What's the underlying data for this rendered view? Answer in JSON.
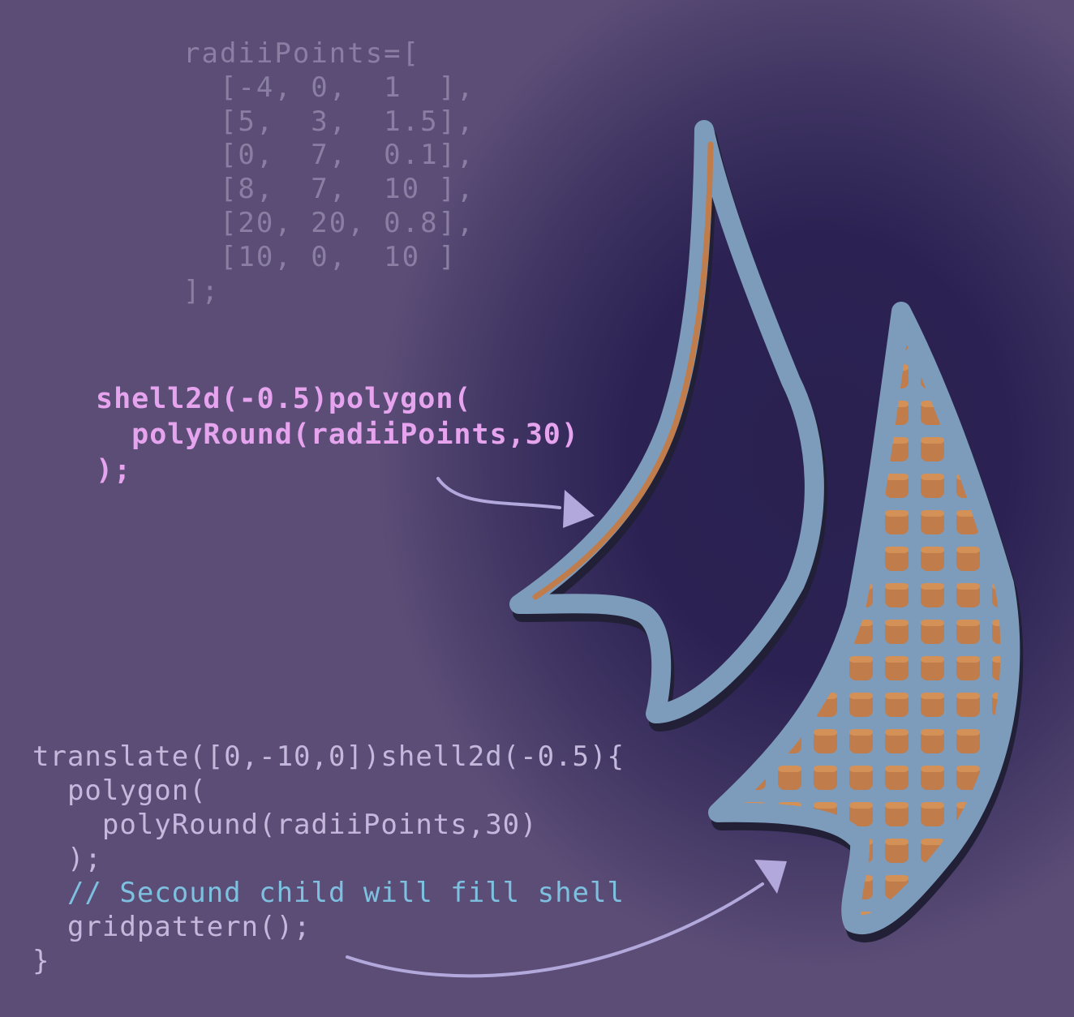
{
  "code_blocks": {
    "radii": {
      "lines": [
        "radiiPoints=[",
        "  [-4, 0,  1  ],",
        "  [5,  3,  1.5],",
        "  [0,  7,  0.1],",
        "  [8,  7,  10 ],",
        "  [20, 20, 0.8],",
        "  [10, 0,  10 ]",
        "];"
      ]
    },
    "shell": {
      "lines": [
        "shell2d(-0.5)polygon(",
        "  polyRound(radiiPoints,30)",
        ");"
      ]
    },
    "translate": {
      "lines": [
        "translate([0,-10,0])shell2d(-0.5){",
        "  polygon(",
        "    polyRound(radiiPoints,30)",
        "  );",
        "  // Secound child will fill shell",
        "  gridpattern();",
        "}"
      ]
    }
  },
  "colors": {
    "background": "#5b4d76",
    "shadow": "#2a2150",
    "code_grey": "#8a7fa3",
    "code_pink": "#e6a3ee",
    "code_light": "#c4b9dc",
    "comment_blue": "#7ec0e0",
    "shell_blue": "#7d9cbc",
    "inner_orange": "#c07c4a",
    "arrow_lavender": "#b3a8dc"
  }
}
